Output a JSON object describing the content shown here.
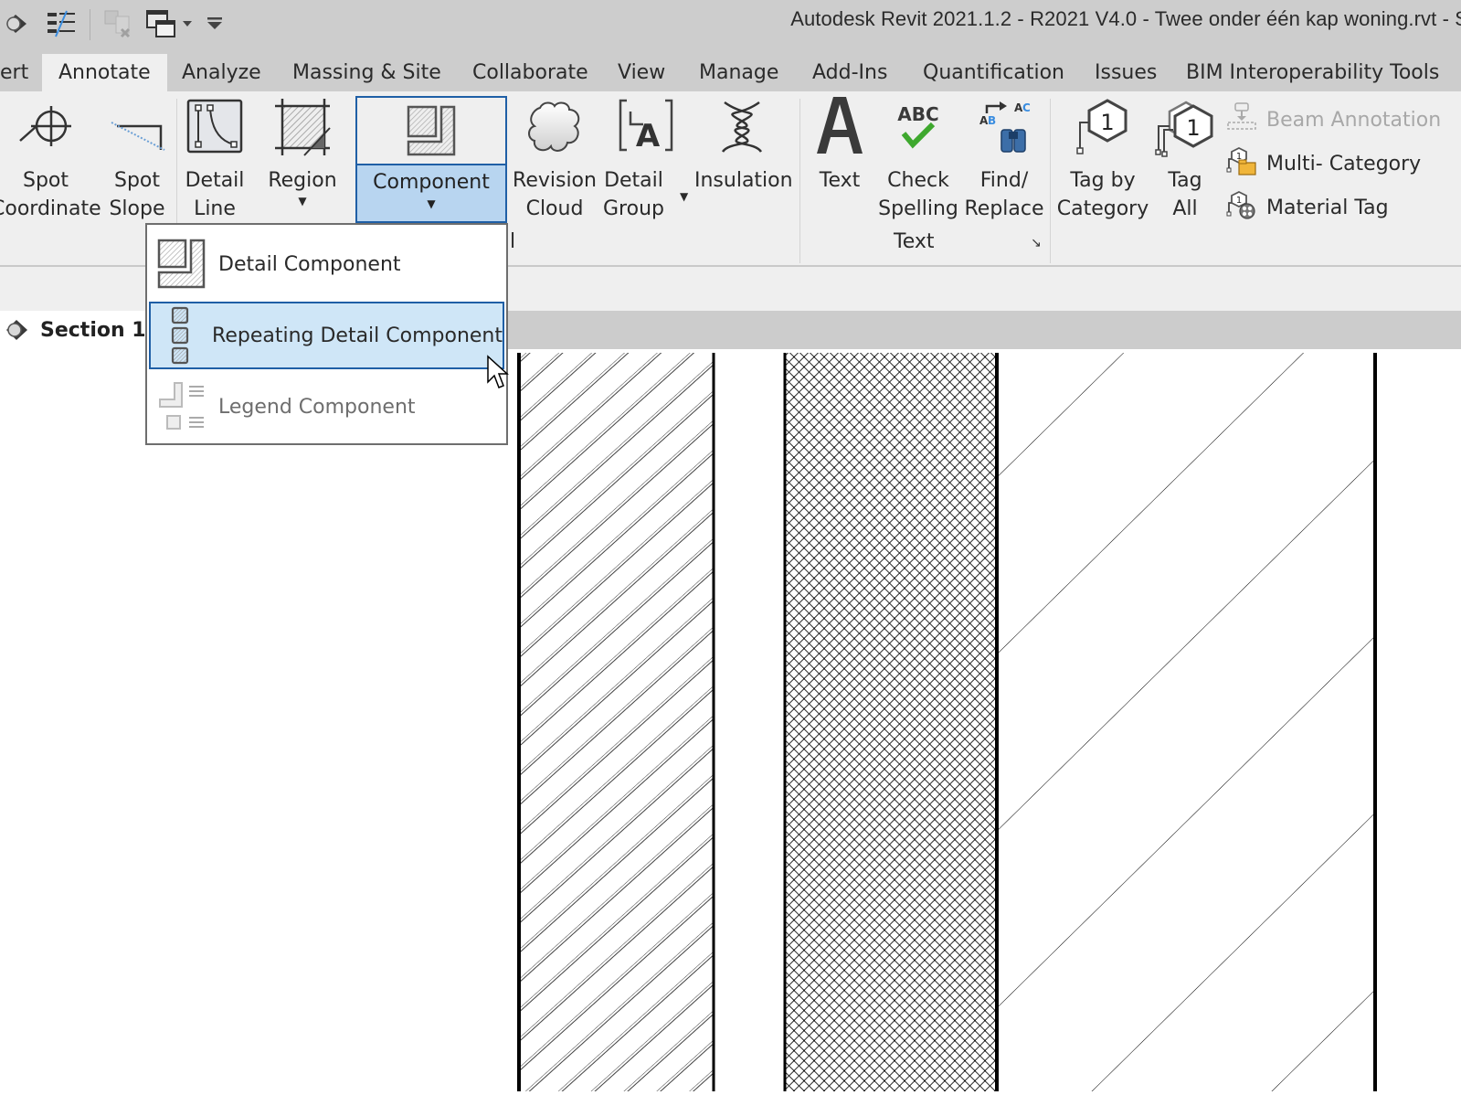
{
  "window": {
    "title": "Autodesk Revit 2021.1.2 - R2021 V4.0 - Twee onder één kap woning.rvt - S"
  },
  "quick_access": [
    {
      "icon": "revit-app-icon"
    },
    {
      "icon": "thin-lines-icon"
    },
    {
      "icon": "close-inactive-views-icon"
    },
    {
      "icon": "switch-windows-icon"
    },
    {
      "icon": "customize-qat-dropdown-icon"
    }
  ],
  "tabs": [
    {
      "label": "ert",
      "active": false
    },
    {
      "label": "Annotate",
      "active": true
    },
    {
      "label": "Analyze",
      "active": false
    },
    {
      "label": "Massing & Site",
      "active": false
    },
    {
      "label": "Collaborate",
      "active": false
    },
    {
      "label": "View",
      "active": false
    },
    {
      "label": "Manage",
      "active": false
    },
    {
      "label": "Add-Ins",
      "active": false
    },
    {
      "label": "Quantification",
      "active": false
    },
    {
      "label": "Issues",
      "active": false
    },
    {
      "label": "BIM Interoperability Tools",
      "active": false
    }
  ],
  "ribbon": {
    "spot_coordinate": {
      "line1": "Spot",
      "line2": "Coordinate"
    },
    "spot_slope": {
      "line1": "Spot",
      "line2": "Slope"
    },
    "detail_line": {
      "line1": "Detail",
      "line2": "Line"
    },
    "region": {
      "line1": "Region"
    },
    "component": {
      "line1": "Component"
    },
    "revision_cloud": {
      "line1": "Revision",
      "line2": "Cloud"
    },
    "detail_group": {
      "line1": "Detail",
      "line2": "Group"
    },
    "insulation": {
      "line1": "Insulation"
    },
    "text": {
      "line1": "Text"
    },
    "check_spelling": {
      "line1": "Check",
      "line2": "Spelling"
    },
    "find_replace": {
      "line1": "Find/",
      "line2": "Replace"
    },
    "text_panel_label": "Text",
    "detail_panel_label": "l",
    "tag_by_category": {
      "line1": "Tag by",
      "line2": "Category"
    },
    "tag_all": {
      "line1": "Tag",
      "line2": "All"
    },
    "beam_annotation": "Beam  Annotation",
    "multi_category": "Multi- Category",
    "material_tag": "Material  Tag"
  },
  "view": {
    "tab_label": "Section 1"
  },
  "dropdown": {
    "items": [
      {
        "label": "Detail Component",
        "state": "normal"
      },
      {
        "label": "Repeating Detail Component",
        "state": "hover"
      },
      {
        "label": "Legend Component",
        "state": "disabled"
      }
    ]
  },
  "colors": {
    "accent_blue": "#1f5fa6",
    "highlight_fill": "#cfe6f7",
    "component_button_fill": "#b8d5f0",
    "ribbon_bg": "#efefef",
    "titlebar_bg": "#cdcdcd"
  }
}
